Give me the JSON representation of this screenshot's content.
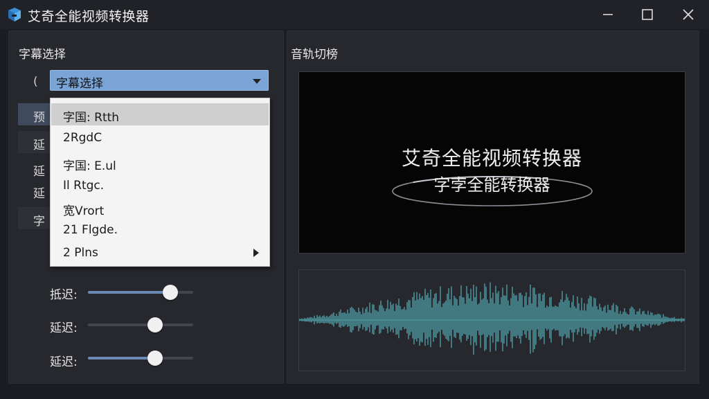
{
  "window": {
    "title": "艾奇全能视频转换器",
    "icon": "app-logo-icon",
    "controls": [
      "minimize-icon",
      "maximize-icon",
      "close-icon"
    ]
  },
  "left_panel": {
    "title": "字幕选择",
    "paren": "(",
    "combo": {
      "value": "字幕选择"
    },
    "background_rows": [
      "预",
      "延",
      "延",
      "延",
      "字"
    ],
    "dropdown": {
      "items": [
        {
          "label": "字国: Rtth",
          "selected": true
        },
        {
          "label": "2RgdC"
        },
        {
          "label": "字国: E.ul"
        },
        {
          "label": "Il Rtgc."
        },
        {
          "label": "宽Vrort"
        },
        {
          "label": "21 Flgde."
        },
        {
          "label": "2 Plns",
          "submenu": true
        }
      ]
    },
    "sliders": [
      {
        "label": "抵迟:",
        "value": 0.78
      },
      {
        "label": "延迟:",
        "value": 0.64
      },
      {
        "label": "延迟:",
        "value": 0.64
      }
    ]
  },
  "right_panel": {
    "title": "音轨切榜",
    "preview": {
      "line1": "艾奇全能视频转换器",
      "line2": "字孛全能转换器"
    }
  },
  "colors": {
    "accent": "#7aa3d6",
    "waveform": "#4f9aa4",
    "background": "#1b1d22"
  }
}
